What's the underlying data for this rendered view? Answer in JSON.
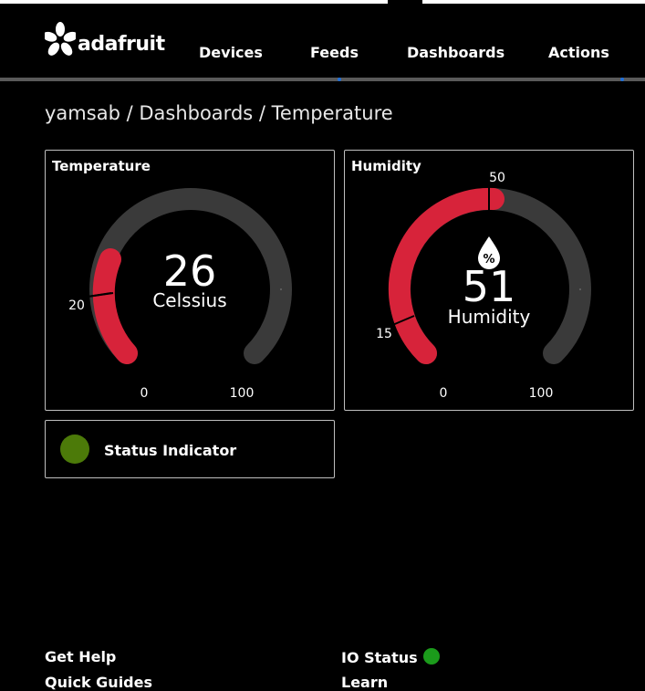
{
  "header": {
    "brand": "adafruit",
    "nav": [
      {
        "label": "Devices"
      },
      {
        "label": "Feeds"
      },
      {
        "label": "Dashboards"
      },
      {
        "label": "Actions"
      }
    ]
  },
  "breadcrumb": {
    "user": "yamsab",
    "sep1": " / ",
    "section": "Dashboards",
    "sep2": " / ",
    "page": "Temperature"
  },
  "gauges": [
    {
      "title": "Temperature",
      "value": "26",
      "unit": "Celssius",
      "min": "0",
      "max": "100",
      "threshold": "20",
      "icon": "",
      "colors": {
        "fill": "#d7233a",
        "track": "#3a3a3a"
      }
    },
    {
      "title": "Humidity",
      "value": "51",
      "unit": "Humidity",
      "min": "0",
      "max": "100",
      "threshold": "15",
      "mark": "50",
      "icon": "humidity-percent-drop-icon",
      "colors": {
        "fill": "#d7233a",
        "track": "#3a3a3a"
      }
    }
  ],
  "status_indicator": {
    "label": "Status Indicator",
    "color": "#4c7a09"
  },
  "footer": {
    "get_help": "Get Help",
    "quick_guides": "Quick Guides",
    "io_status": "IO Status",
    "io_status_color": "#1b9b1b",
    "learn": "Learn"
  }
}
